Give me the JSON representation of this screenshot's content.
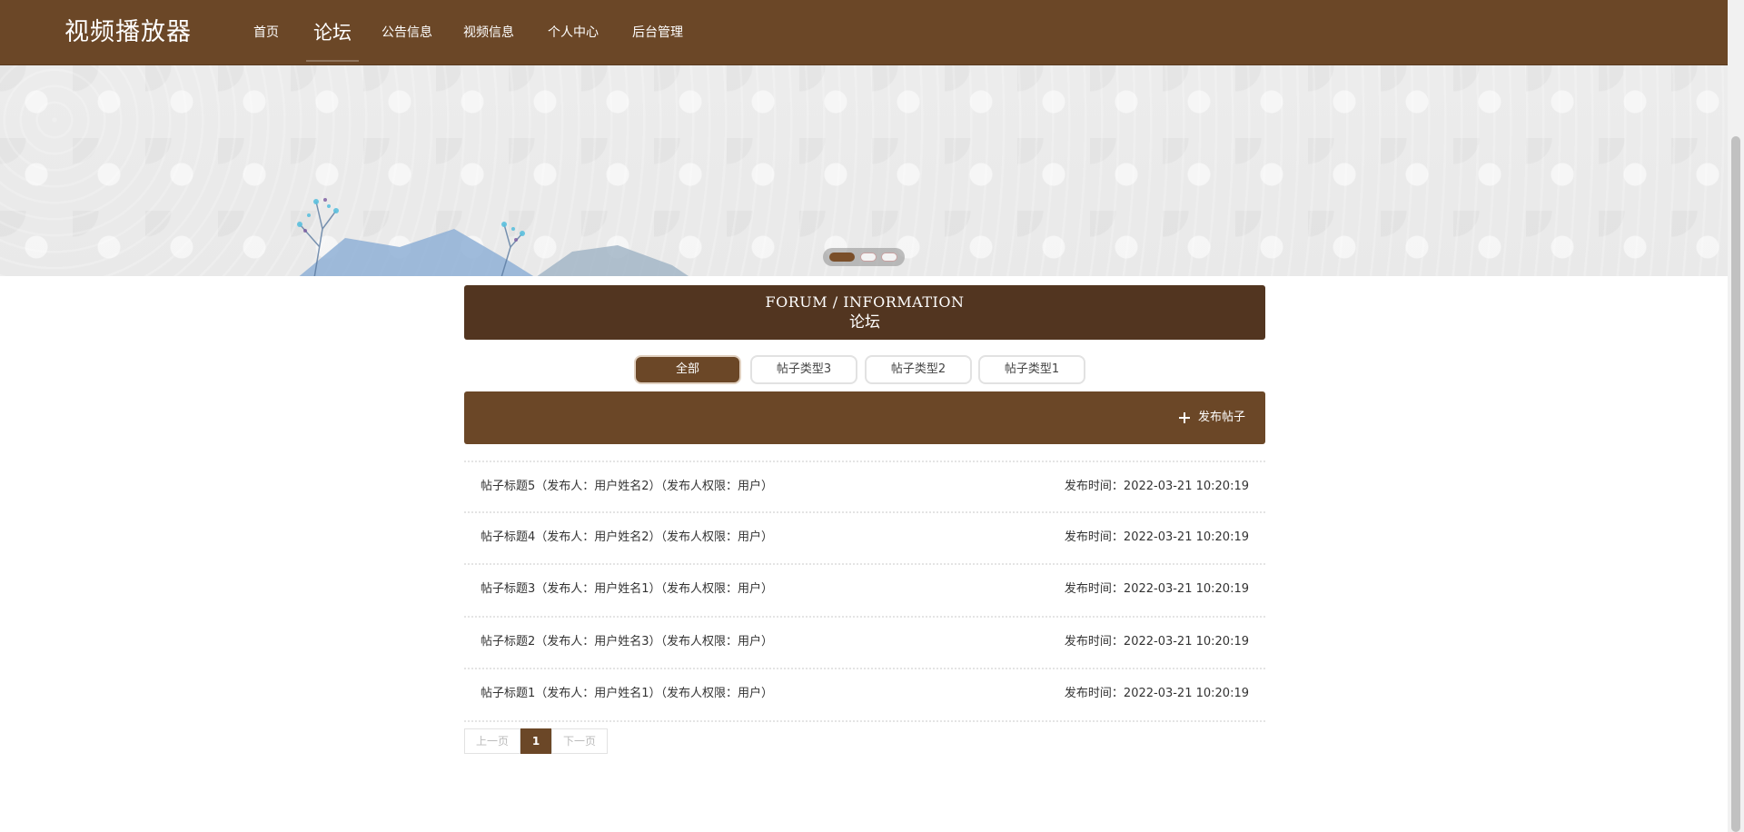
{
  "brand": "视频播放器",
  "nav": [
    {
      "label": "首页",
      "active": false
    },
    {
      "label": "论坛",
      "active": true
    },
    {
      "label": "公告信息",
      "active": false
    },
    {
      "label": "视频信息",
      "active": false
    },
    {
      "label": "个人中心",
      "active": false
    },
    {
      "label": "后台管理",
      "active": false
    }
  ],
  "banner": {
    "slides": 3,
    "active_slide": 1
  },
  "section": {
    "title_en": "FORUM / INFORMATION",
    "title_cn": "论坛"
  },
  "categories": [
    {
      "label": "全部",
      "active": true
    },
    {
      "label": "帖子类型3",
      "active": false
    },
    {
      "label": "帖子类型2",
      "active": false
    },
    {
      "label": "帖子类型1",
      "active": false
    }
  ],
  "actions": {
    "publish_label": "发布帖子"
  },
  "posts": [
    {
      "title": "帖子标题5（发布人：用户姓名2）（发布人权限：用户）",
      "time": "发布时间：2022-03-21 10:20:19"
    },
    {
      "title": "帖子标题4（发布人：用户姓名2）（发布人权限：用户）",
      "time": "发布时间：2022-03-21 10:20:19"
    },
    {
      "title": "帖子标题3（发布人：用户姓名1）（发布人权限：用户）",
      "time": "发布时间：2022-03-21 10:20:19"
    },
    {
      "title": "帖子标题2（发布人：用户姓名3）（发布人权限：用户）",
      "time": "发布时间：2022-03-21 10:20:19"
    },
    {
      "title": "帖子标题1（发布人：用户姓名1）（发布人权限：用户）",
      "time": "发布时间：2022-03-21 10:20:19"
    }
  ],
  "pagination": {
    "prev": "上一页",
    "current": "1",
    "next": "下一页"
  },
  "colors": {
    "primary": "#6b4727",
    "primary_dark": "#523520"
  }
}
